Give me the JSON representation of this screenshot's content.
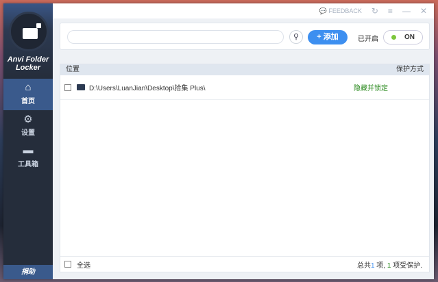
{
  "app": {
    "name": "Anvi Folder Locker"
  },
  "sidebar": {
    "items": [
      {
        "label": "首页",
        "icon": "home-icon"
      },
      {
        "label": "设置",
        "icon": "gear-icon"
      },
      {
        "label": "工具箱",
        "icon": "toolbox-icon"
      }
    ],
    "donate": "捐助"
  },
  "titlebar": {
    "feedback": "FEEDBACK"
  },
  "toolbar": {
    "search_placeholder": "",
    "add_label": "添加",
    "status_label": "已开启",
    "toggle_label": "ON"
  },
  "table": {
    "headers": [
      "位置",
      "保护方式"
    ],
    "rows": [
      {
        "path": "D:\\Users\\LuanJian\\Desktop\\拾集 Plus\\",
        "mode": "隐藏并锁定"
      }
    ]
  },
  "footer": {
    "select_all": "全选",
    "sum_pre": "总共",
    "total": "1",
    "sum_mid": " 项, ",
    "protected": "1",
    "sum_post": " 项受保护."
  }
}
